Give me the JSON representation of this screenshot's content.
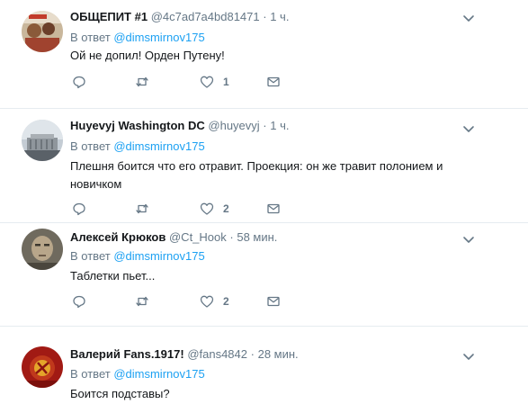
{
  "tweets": [
    {
      "name": "ОБЩЕПИТ #1",
      "handle": "@4c7ad7a4bd81471",
      "time": "1 ч.",
      "reply_prefix": "В ответ",
      "reply_to": "@dimsmirnov175",
      "text": "Ой не допил! Орден Путену!",
      "likes": "1"
    },
    {
      "name": "Huyevyj Washington DC",
      "handle": "@huyevyj",
      "time": "1 ч.",
      "reply_prefix": "В ответ",
      "reply_to": "@dimsmirnov175",
      "text": "Плешня боится что его отравит. Проекция: он же травит полонием и новичком",
      "likes": "2"
    },
    {
      "name": "Алексей Крюков",
      "handle": "@Ct_Hook",
      "time": "58 мин.",
      "reply_prefix": "В ответ",
      "reply_to": "@dimsmirnov175",
      "text": "Таблетки пьет...",
      "likes": "2"
    },
    {
      "name": "Валерий Fans.1917!",
      "handle": "@fans4842",
      "time": "28 мин.",
      "reply_prefix": "В ответ",
      "reply_to": "@dimsmirnov175",
      "text": "Боится подставы?",
      "likes": ""
    }
  ],
  "separator": "·",
  "icons": {
    "reply": "reply-icon",
    "retweet": "retweet-icon",
    "like": "heart-icon",
    "message": "envelope-icon",
    "menu": "chevron-down-icon"
  },
  "colors": {
    "link": "#1da1f2",
    "secondary": "#657786",
    "divider": "#e6ecf0"
  }
}
